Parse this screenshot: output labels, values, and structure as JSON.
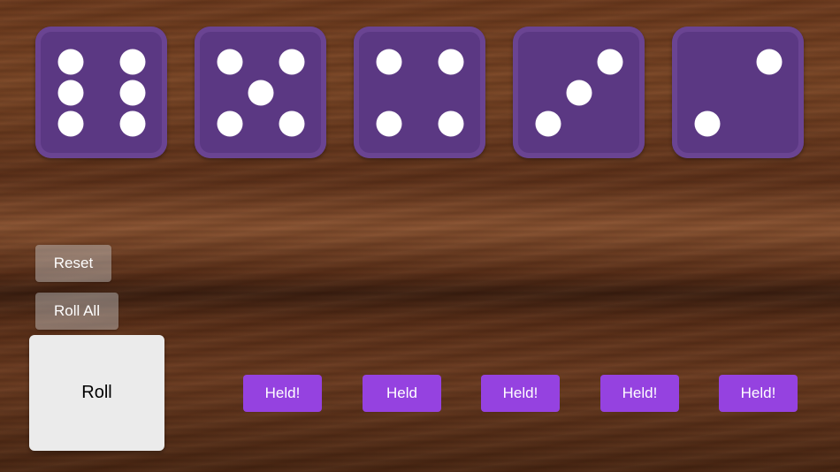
{
  "dice": [
    {
      "value": 6
    },
    {
      "value": 5
    },
    {
      "value": 4
    },
    {
      "value": 3
    },
    {
      "value": 2
    }
  ],
  "controls": {
    "reset_label": "Reset",
    "roll_all_label": "Roll All",
    "roll_label": "Roll"
  },
  "hold_buttons": [
    {
      "label": "Held!"
    },
    {
      "label": "Held"
    },
    {
      "label": "Held!"
    },
    {
      "label": "Held!"
    },
    {
      "label": "Held!"
    }
  ],
  "colors": {
    "die_face": "#5b3883",
    "pip": "#ffffff",
    "held_button": "#9542e0",
    "roll_button": "#ebebeb"
  }
}
